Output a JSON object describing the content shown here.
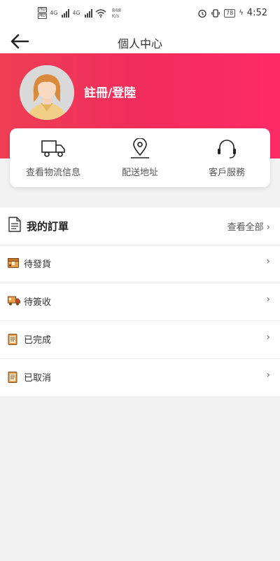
{
  "status_bar": {
    "hd_top": "HD",
    "hd_bottom": "HD",
    "net_type_1": "4G",
    "net_type_2": "4G",
    "speed_value": "848",
    "speed_unit": "K/s",
    "battery": "78",
    "time": "4:52"
  },
  "header": {
    "title": "個人中心"
  },
  "profile": {
    "login_label": "註冊/登陸"
  },
  "quick_actions": [
    {
      "label": "查看物流信息"
    },
    {
      "label": "配送地址"
    },
    {
      "label": "客戶服務"
    }
  ],
  "orders": {
    "title": "我的訂單",
    "view_all": "查看全部 ›",
    "items": [
      {
        "label": "待發貨"
      },
      {
        "label": "待簽收"
      },
      {
        "label": "已完成"
      },
      {
        "label": "已取消"
      }
    ]
  },
  "colors": {
    "accent": "#f02d5c",
    "icon_orange": "#e58a2a"
  }
}
